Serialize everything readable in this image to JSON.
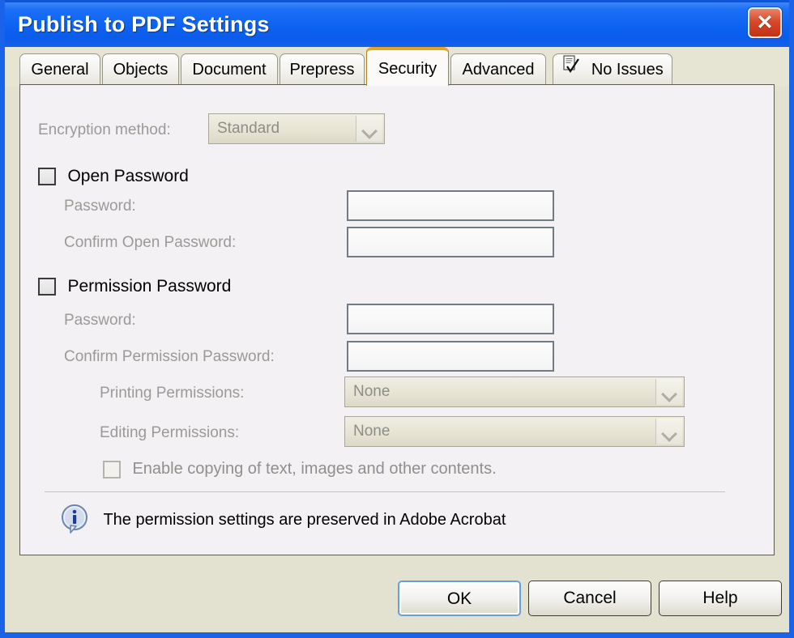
{
  "window": {
    "title": "Publish to PDF Settings",
    "close_label": "✕",
    "close_icon": "close-icon",
    "titlebar_color": "#0f64f2",
    "body_color": "#e3e1cf"
  },
  "tabs": {
    "items": [
      {
        "label": "General",
        "active": false,
        "icon": null
      },
      {
        "label": "Objects",
        "active": false,
        "icon": null
      },
      {
        "label": "Document",
        "active": false,
        "icon": null
      },
      {
        "label": "Prepress",
        "active": false,
        "icon": null
      },
      {
        "label": "Security",
        "active": true,
        "icon": null
      },
      {
        "label": "Advanced",
        "active": false,
        "icon": null
      },
      {
        "label": "No Issues",
        "active": false,
        "icon": "document-check-icon"
      }
    ],
    "active_tab": "Security",
    "active_accent_color": "#e8a426"
  },
  "security": {
    "encryption": {
      "label": "Encryption method:",
      "value": "Standard",
      "enabled": false
    },
    "open_password": {
      "checkbox_label": "Open Password",
      "checked": false,
      "enabled": true,
      "password_label": "Password:",
      "password_value": "",
      "confirm_label": "Confirm Open Password:",
      "confirm_value": ""
    },
    "permission_password": {
      "checkbox_label": "Permission Password",
      "checked": false,
      "enabled": true,
      "password_label": "Password:",
      "password_value": "",
      "confirm_label": "Confirm Permission Password:",
      "confirm_value": "",
      "printing_label": "Printing Permissions:",
      "printing_value": "None",
      "editing_label": "Editing Permissions:",
      "editing_value": "None",
      "copy_label": "Enable copying of text, images and other contents.",
      "copy_checked": false,
      "copy_enabled": false
    },
    "note": {
      "icon": "info-icon",
      "text": "The permission settings are preserved in Adobe Acrobat"
    }
  },
  "footer": {
    "ok_label": "OK",
    "cancel_label": "Cancel",
    "help_label": "Help",
    "default_button": "OK"
  }
}
